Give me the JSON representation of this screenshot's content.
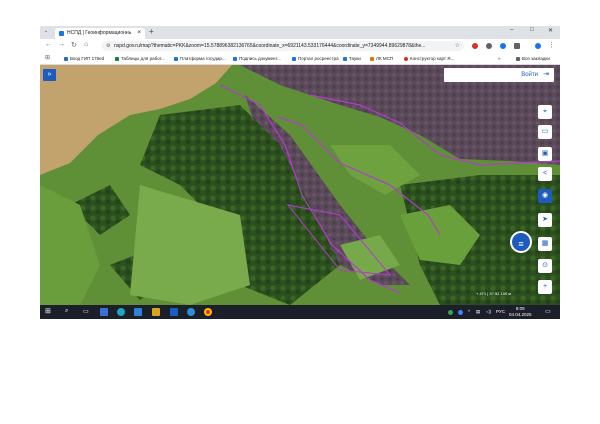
{
  "browser": {
    "tab_title": "НСПД | Геоинформационный...",
    "tab_close": "×",
    "tab_list": "⌄",
    "new_tab": "+",
    "url": "nspd.gov.ru/map?thematic=PKK&zoom=15.578896382136765&coordinate_x=6921143.533176444&coordinate_y=7349944.89629878&the...",
    "window_controls": [
      "–",
      "□",
      "✕"
    ]
  },
  "bookmarks": {
    "items": [
      {
        "label": "Вход ГИП 179ed",
        "color": "#2b6cb0"
      },
      {
        "label": "Таблицы для работ...",
        "color": "#188038"
      },
      {
        "label": "Платформа государ...",
        "color": "#1a73e8"
      },
      {
        "label": "Подпись документ...",
        "color": "#1a73e8"
      },
      {
        "label": "Портал росреестра",
        "color": "#1a73e8"
      },
      {
        "label": "Тауки",
        "color": "#1a73e8"
      },
      {
        "label": "ЛК МСП",
        "color": "#e37400"
      },
      {
        "label": "Конструктор карт Я...",
        "color": "#d93025"
      }
    ],
    "more": "»",
    "all": "Все закладки"
  },
  "map": {
    "expand": "»",
    "login_label": "Войти",
    "scale": "+ 471 | 37.52  100 м",
    "side_buttons": [
      {
        "icon": "location-pin-icon",
        "glyph": "⌖"
      },
      {
        "icon": "layers-icon",
        "glyph": "▭"
      },
      {
        "icon": "image-icon",
        "glyph": "▣"
      },
      {
        "icon": "share-icon",
        "glyph": "<"
      },
      {
        "icon": "speech-icon",
        "glyph": "◉"
      },
      {
        "icon": "navigate-icon",
        "glyph": "➤"
      },
      {
        "icon": "photo-icon",
        "glyph": "▦"
      },
      {
        "icon": "search-icon",
        "glyph": "⊙"
      },
      {
        "icon": "zoom-in-icon",
        "glyph": "+"
      }
    ],
    "chat": "≡"
  },
  "taskbar": {
    "time": "8:08",
    "date": "04.04.2025",
    "lang": "РУС"
  }
}
